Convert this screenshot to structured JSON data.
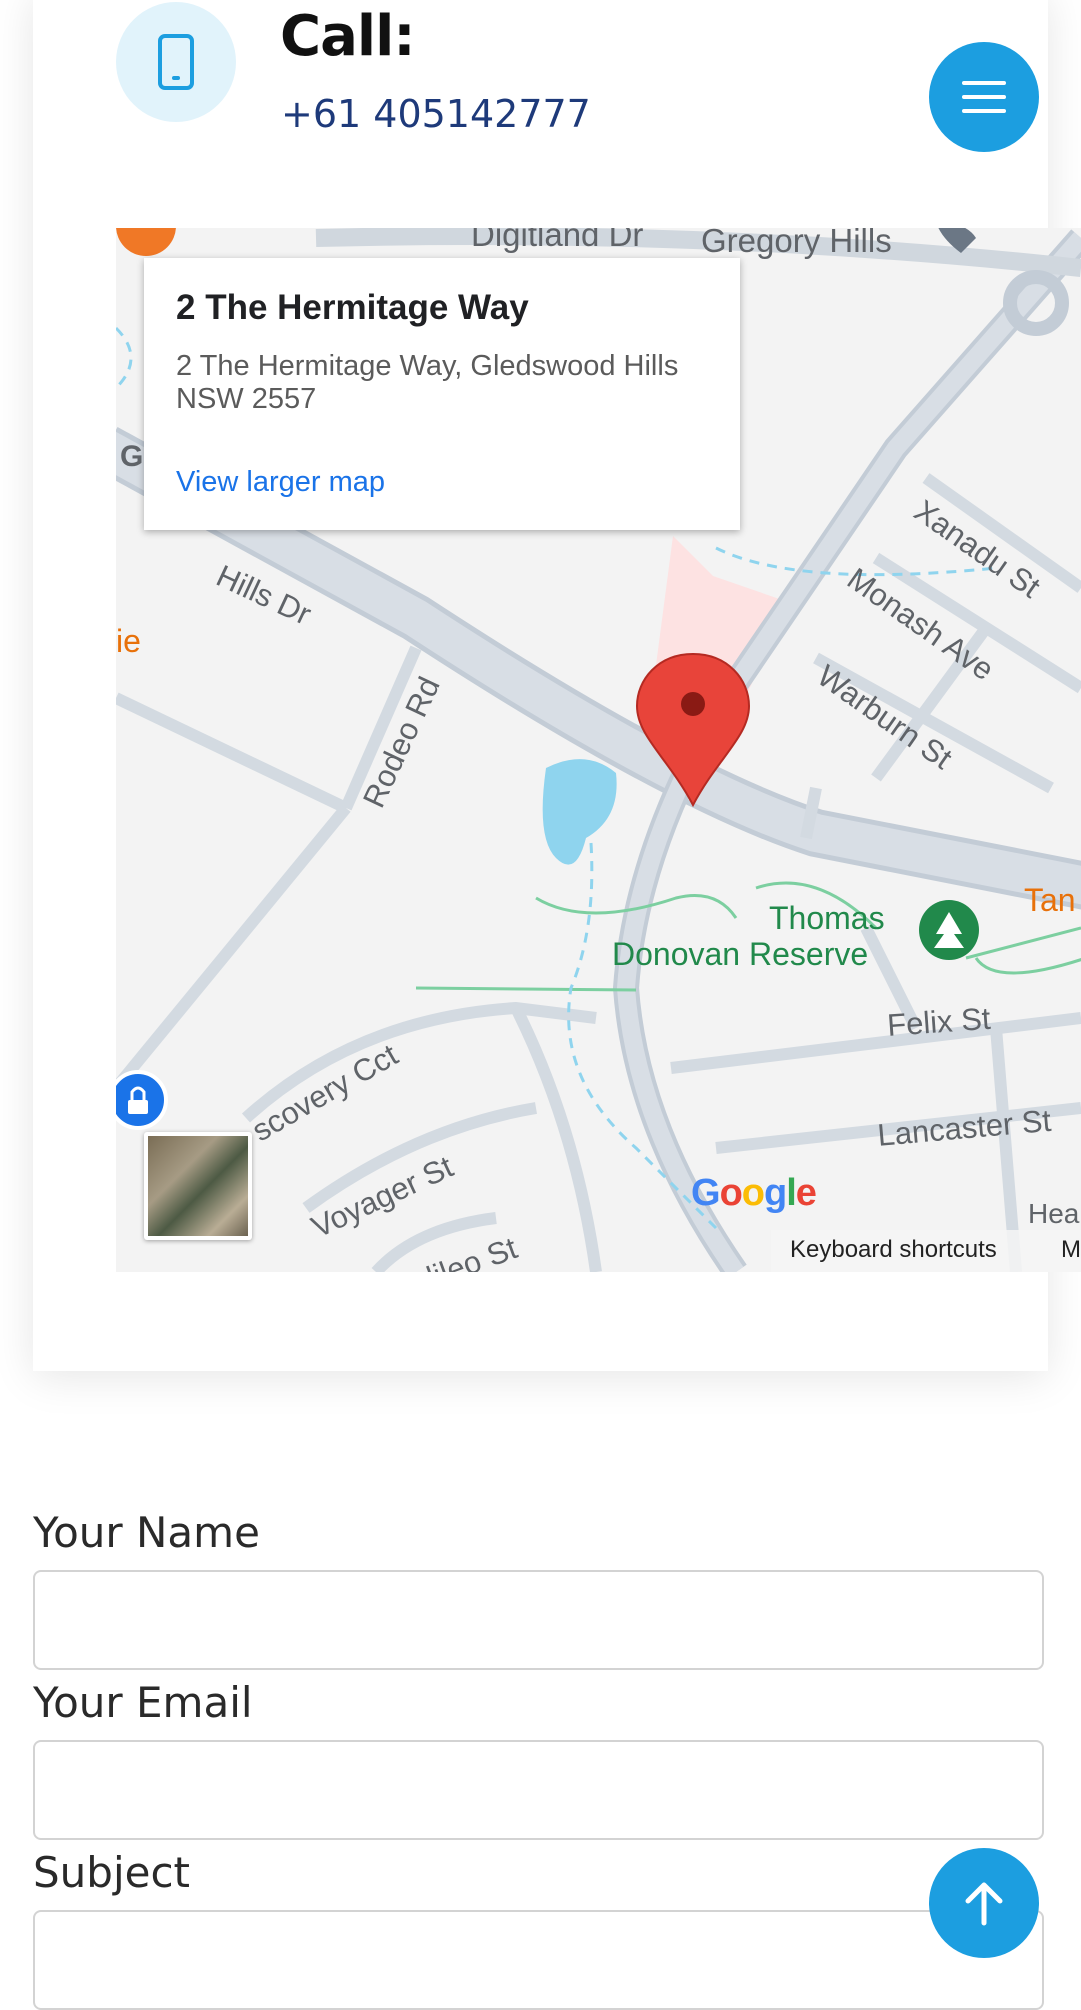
{
  "contact": {
    "call_title": "Call:",
    "phone_number": "+61 405142777"
  },
  "map": {
    "info": {
      "title": "2 The Hermitage Way",
      "address": "2 The Hermitage Way, Gledswood Hills NSW 2557",
      "link": "View larger map"
    },
    "streets": {
      "digitland": "Digitland Dr",
      "gregory_hills": "Gregory Hills",
      "hills_dr": "Hills Dr",
      "xanadu": "Xanadu St",
      "monash": "Monash Ave",
      "warburn": "Warburn St",
      "rodeo": "Rodeo Rd",
      "discovery": "scovery Cct",
      "voyager": "Voyager St",
      "galileo": "alileo St",
      "felix": "Felix St",
      "lancaster": "Lancaster St",
      "thomas": "Thomas",
      "donovan": "Donovan Reserve",
      "tan": "Tan",
      "ie": "ie",
      "g": "G",
      "hea": "Hea",
      "m": "M"
    },
    "google_logo": "Google",
    "keyboard_shortcuts": "Keyboard shortcuts",
    "colors": {
      "water": "#8fd4ee",
      "road": "#c9d2db",
      "highway": "#b7c1cc",
      "park_label": "#21894b",
      "pin": "#e8443a",
      "highlight": "#fde2e2"
    }
  },
  "form": {
    "name_label": "Your Name",
    "email_label": "Your Email",
    "subject_label": "Subject",
    "name_value": "",
    "email_value": "",
    "subject_value": ""
  },
  "icons": {
    "phone": "phone-icon",
    "menu": "menu-icon",
    "scroll_up": "arrow-up-icon"
  },
  "colors": {
    "accent": "#1c9ee0",
    "icon_bg": "#e1f3fb",
    "phone_text": "#1e3a7a"
  }
}
